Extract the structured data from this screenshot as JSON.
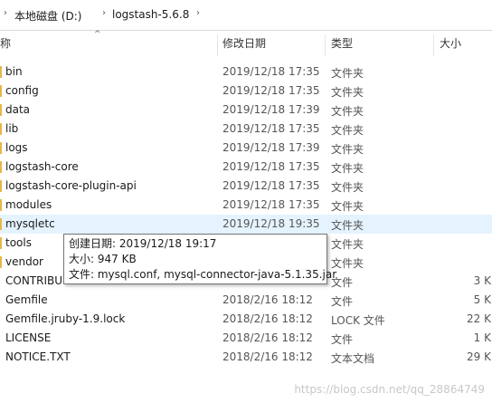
{
  "breadcrumb": {
    "drive": "本地磁盘 (D:)",
    "folder": "logstash-5.6.8"
  },
  "columns": {
    "name": "称",
    "date": "修改日期",
    "type": "类型",
    "size": "大小"
  },
  "rows": [
    {
      "name": "bin",
      "date": "2019/12/18 17:35",
      "type": "文件夹",
      "size": ""
    },
    {
      "name": "config",
      "date": "2019/12/18 17:35",
      "type": "文件夹",
      "size": ""
    },
    {
      "name": "data",
      "date": "2019/12/18 17:39",
      "type": "文件夹",
      "size": ""
    },
    {
      "name": "lib",
      "date": "2019/12/18 17:35",
      "type": "文件夹",
      "size": ""
    },
    {
      "name": "logs",
      "date": "2019/12/18 17:39",
      "type": "文件夹",
      "size": ""
    },
    {
      "name": "logstash-core",
      "date": "2019/12/18 17:35",
      "type": "文件夹",
      "size": ""
    },
    {
      "name": "logstash-core-plugin-api",
      "date": "2019/12/18 17:35",
      "type": "文件夹",
      "size": ""
    },
    {
      "name": "modules",
      "date": "2019/12/18 17:35",
      "type": "文件夹",
      "size": ""
    },
    {
      "name": "mysqletc",
      "date": "2019/12/18 19:35",
      "type": "文件夹",
      "size": ""
    },
    {
      "name": "tools",
      "date": "",
      "type": "文件夹",
      "size": ""
    },
    {
      "name": "vendor",
      "date": "",
      "type": "文件夹",
      "size": ""
    },
    {
      "name": "CONTRIBU",
      "date": "",
      "type": "文件",
      "size": "3 K"
    },
    {
      "name": "Gemfile",
      "date": "2018/2/16 18:12",
      "type": "文件",
      "size": "5 K"
    },
    {
      "name": "Gemfile.jruby-1.9.lock",
      "date": "2018/2/16 18:12",
      "type": "LOCK 文件",
      "size": "22 K"
    },
    {
      "name": "LICENSE",
      "date": "2018/2/16 18:12",
      "type": "文件",
      "size": "1 K"
    },
    {
      "name": "NOTICE.TXT",
      "date": "2018/2/16 18:12",
      "type": "文本文档",
      "size": "29 K"
    }
  ],
  "tooltip": {
    "created": "创建日期: 2019/12/18 19:17",
    "size": "大小: 947 KB",
    "files": "文件: mysql.conf, mysql-connector-java-5.1.35.jar"
  },
  "watermark": "https://blog.csdn.net/qq_28864749",
  "colors": {
    "selected_row": "#e5f3ff",
    "folder": "#e8b648"
  }
}
